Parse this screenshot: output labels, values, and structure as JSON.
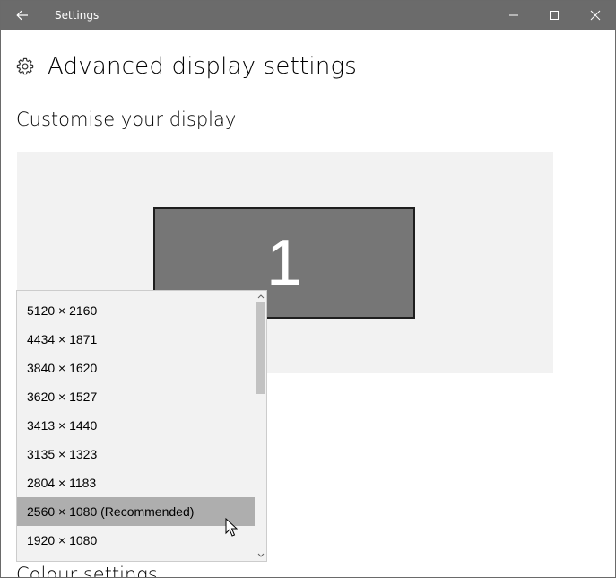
{
  "window": {
    "title": "Settings"
  },
  "header": {
    "title": "Advanced display settings"
  },
  "section": {
    "customise_title": "Customise your display",
    "colour_title": "Colour settings"
  },
  "display": {
    "monitor_number": "1"
  },
  "resolution_dropdown": {
    "items": [
      "5120 × 2160",
      "4434 × 1871",
      "3840 × 1620",
      "3620 × 1527",
      "3413 × 1440",
      "3135 × 1323",
      "2804 × 1183",
      "2560 × 1080 (Recommended)",
      "1920 × 1080"
    ],
    "selected_index": 7
  },
  "colors": {
    "titlebar": "#6b6b6b",
    "selected_item": "#aeaeae",
    "display_area": "#f2f2f2",
    "monitor": "#767676"
  }
}
